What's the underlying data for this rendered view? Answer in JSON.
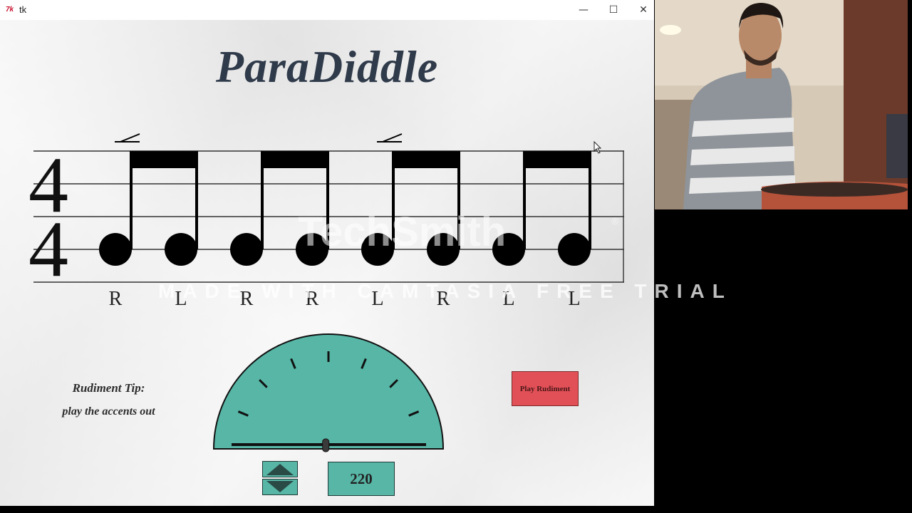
{
  "window": {
    "title": "tk"
  },
  "rudiment": {
    "title": "ParaDiddle",
    "time_signature": {
      "top": "4",
      "bottom": "4"
    },
    "sticking": [
      "R",
      "L",
      "R",
      "R",
      "L",
      "R",
      "L",
      "L"
    ],
    "accents_on_notes": [
      1,
      5
    ]
  },
  "tip": {
    "heading": "Rudiment Tip:",
    "text": "play the accents out"
  },
  "controls": {
    "play_label": "Play Rudiment",
    "tempo": "220",
    "tempo_fraction": 1.0
  },
  "watermark": {
    "logo": "TechSmith",
    "reg": "®",
    "trial": "MADE WITH CAMTASIA FREE TRIAL"
  },
  "colors": {
    "gauge": "#57b6a6",
    "play_button": "#e25057",
    "title": "#2f3a4a"
  },
  "icons": {
    "close": "close-icon",
    "minimize": "minimize-icon",
    "maximize": "maximize-icon"
  }
}
